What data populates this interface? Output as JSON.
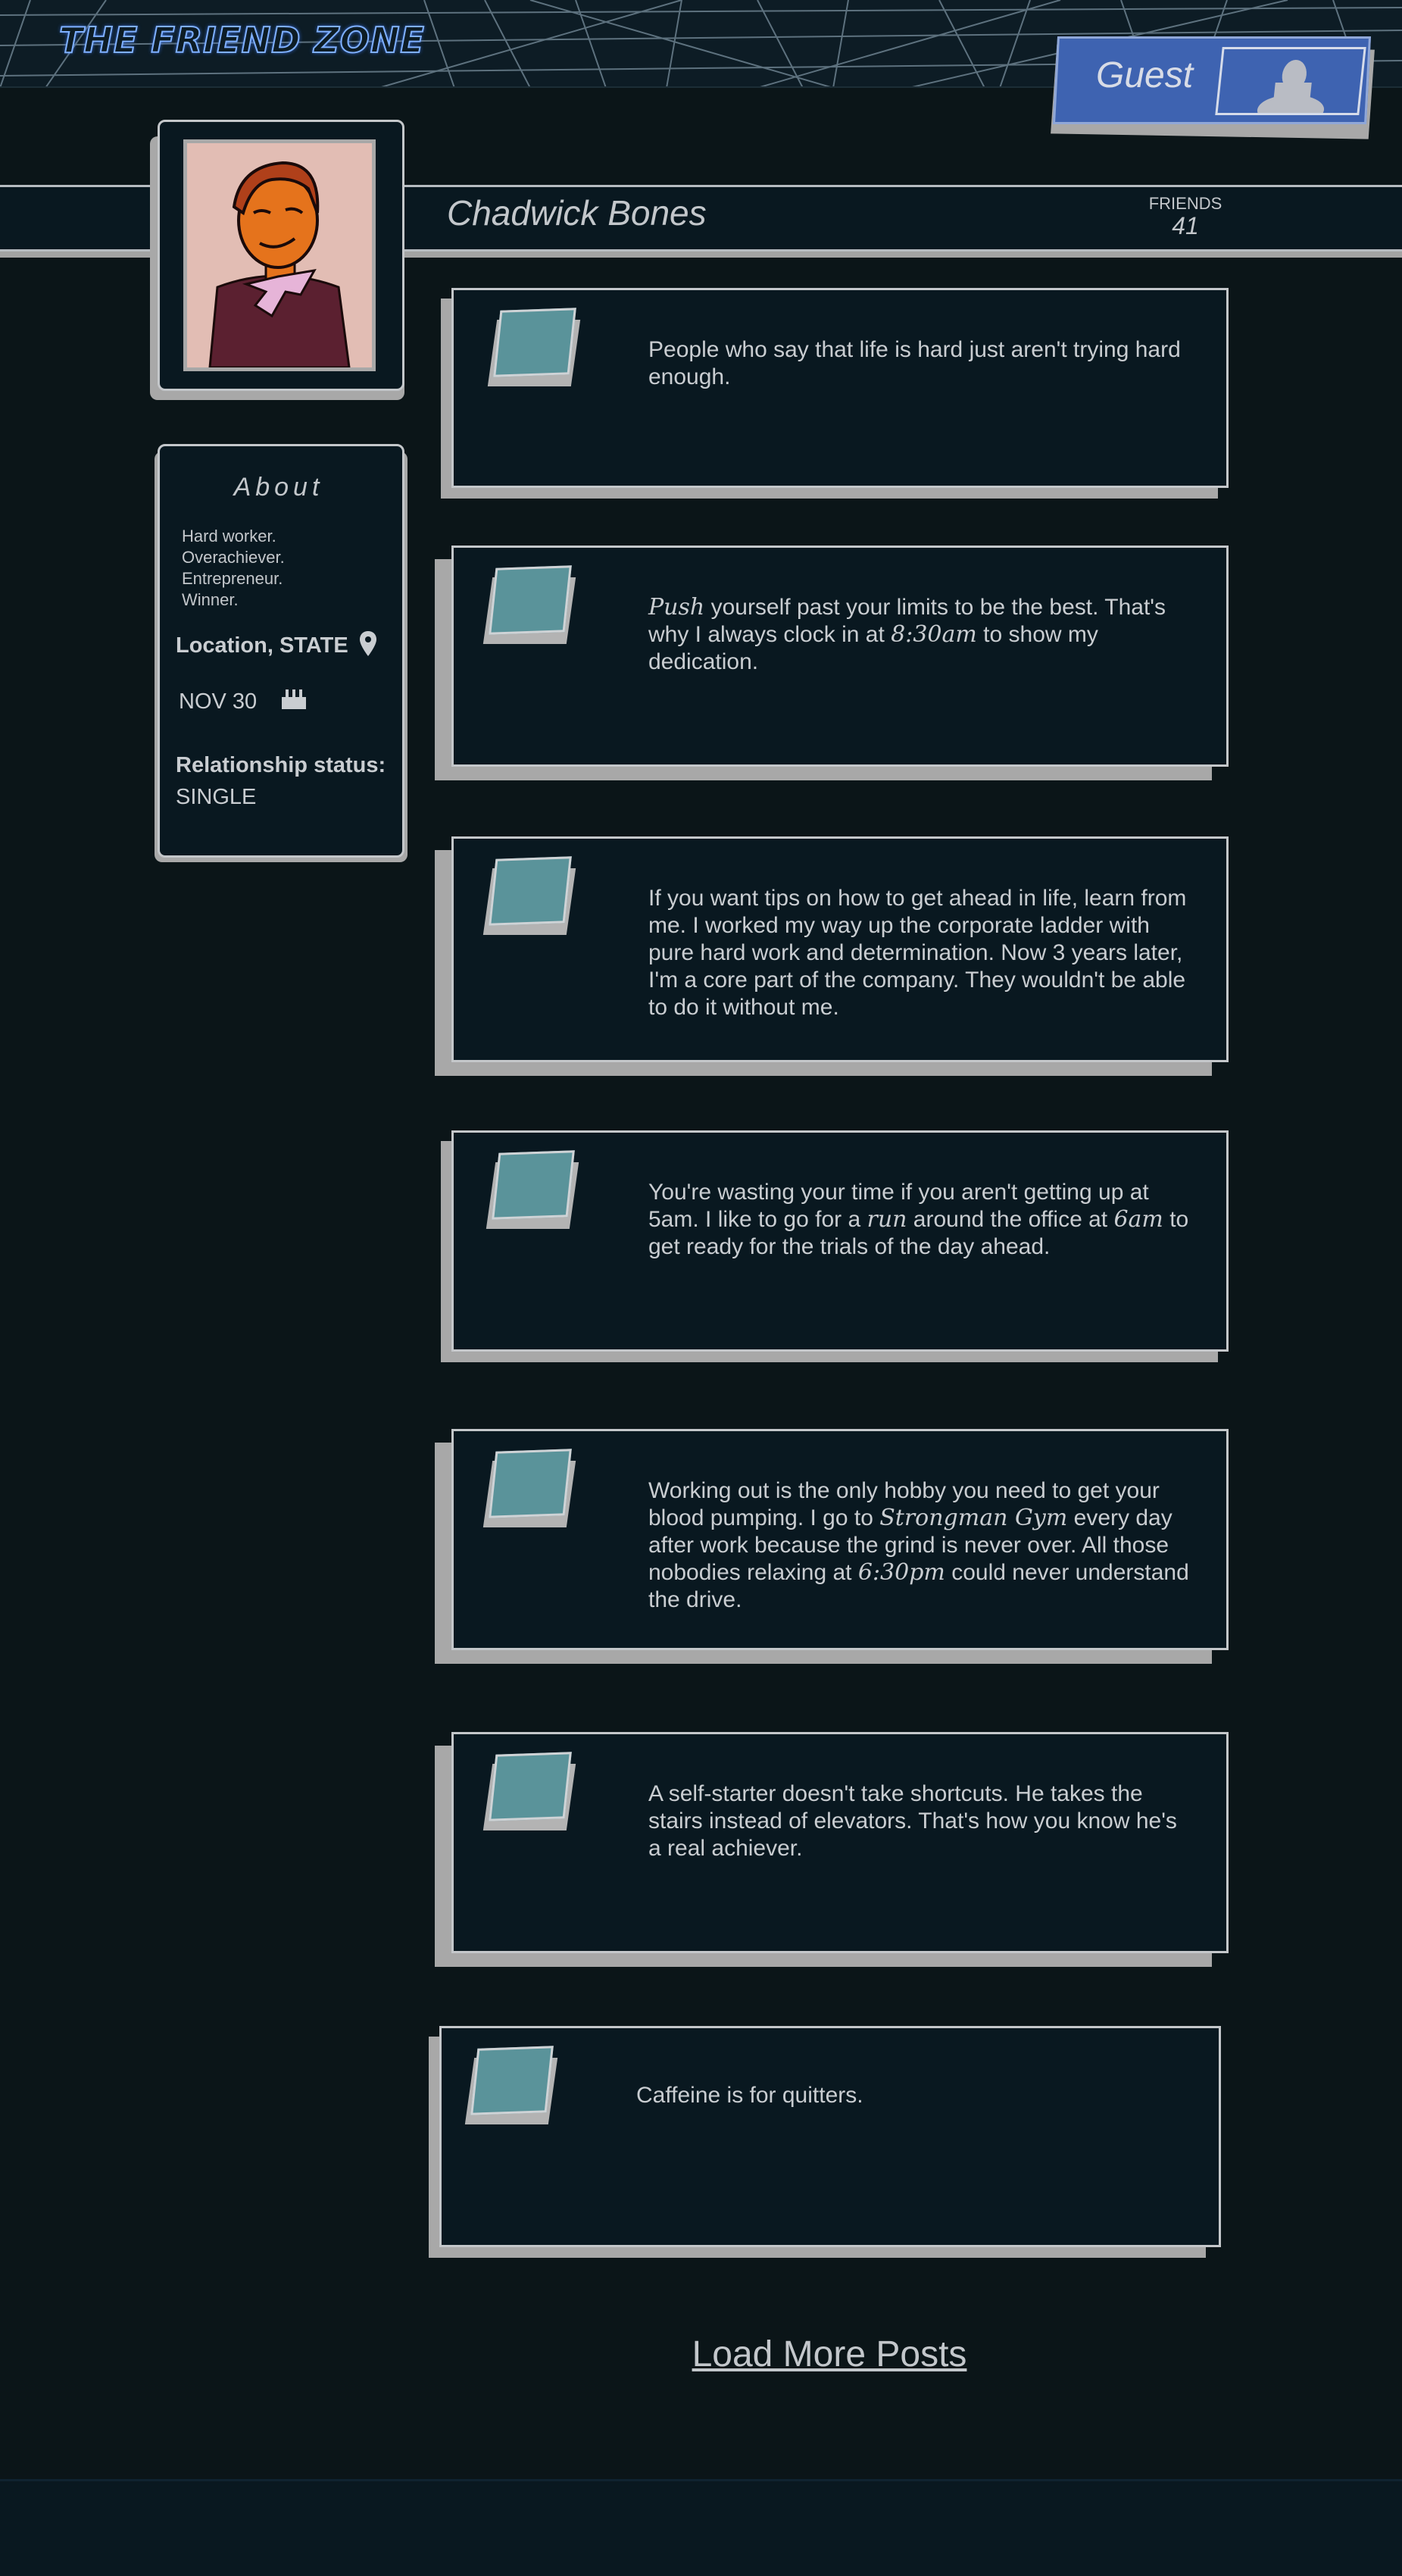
{
  "header": {
    "logo_text": "THE FRIEND ZONE",
    "user_label": "Guest"
  },
  "profile": {
    "name": "Chadwick Bones",
    "friends_label": "FRIENDS",
    "friends_count": "41"
  },
  "about": {
    "title": "About",
    "bio_lines": [
      "Hard worker.",
      "Overachiever.",
      "Entrepreneur.",
      "Winner."
    ],
    "location": "Location, STATE",
    "birthday": "NOV 30",
    "relationship_label": "Relationship status:",
    "relationship_value": "SINGLE"
  },
  "posts": [
    {
      "parts": [
        "People who say that life is hard just aren't trying hard enough."
      ]
    },
    {
      "parts": [
        "Push",
        " yourself past your limits to be the best. That's why I always clock in at ",
        "8:30am",
        " to show my dedication."
      ]
    },
    {
      "parts": [
        "If you want tips on how to get ahead in life, learn from me. I worked my way up the corporate ladder with pure hard work and determination. Now 3 years later, I'm a core part of the company. They wouldn't be able to do it without me."
      ]
    },
    {
      "parts": [
        "You're wasting your time if you aren't getting up at 5am. I like to go for a ",
        "run",
        " around the office at ",
        "6am",
        " to get ready for the trials of the day ahead."
      ]
    },
    {
      "parts": [
        "Working out is the only hobby you need to get your blood pumping. I go to ",
        "Strongman Gym",
        " every day after work because the grind is never over. All those nobodies relaxing at ",
        "6:30pm",
        " could never understand the drive."
      ]
    },
    {
      "parts": [
        "A self-starter doesn't take shortcuts. He takes the stairs instead of elevators. That's how you know he's a real achiever."
      ]
    },
    {
      "parts": [
        "Caffeine is for quitters."
      ]
    }
  ],
  "load_more_label": "Load More Posts",
  "colors": {
    "background": "#0b1518",
    "panel": "#091820",
    "accent_blue": "#3e63b1",
    "post_square": "#5a939a",
    "shadow_gray": "#a8a8a8"
  },
  "icons": [
    "location-pin-icon",
    "birthday-cake-icon",
    "guest-avatar-icon"
  ]
}
